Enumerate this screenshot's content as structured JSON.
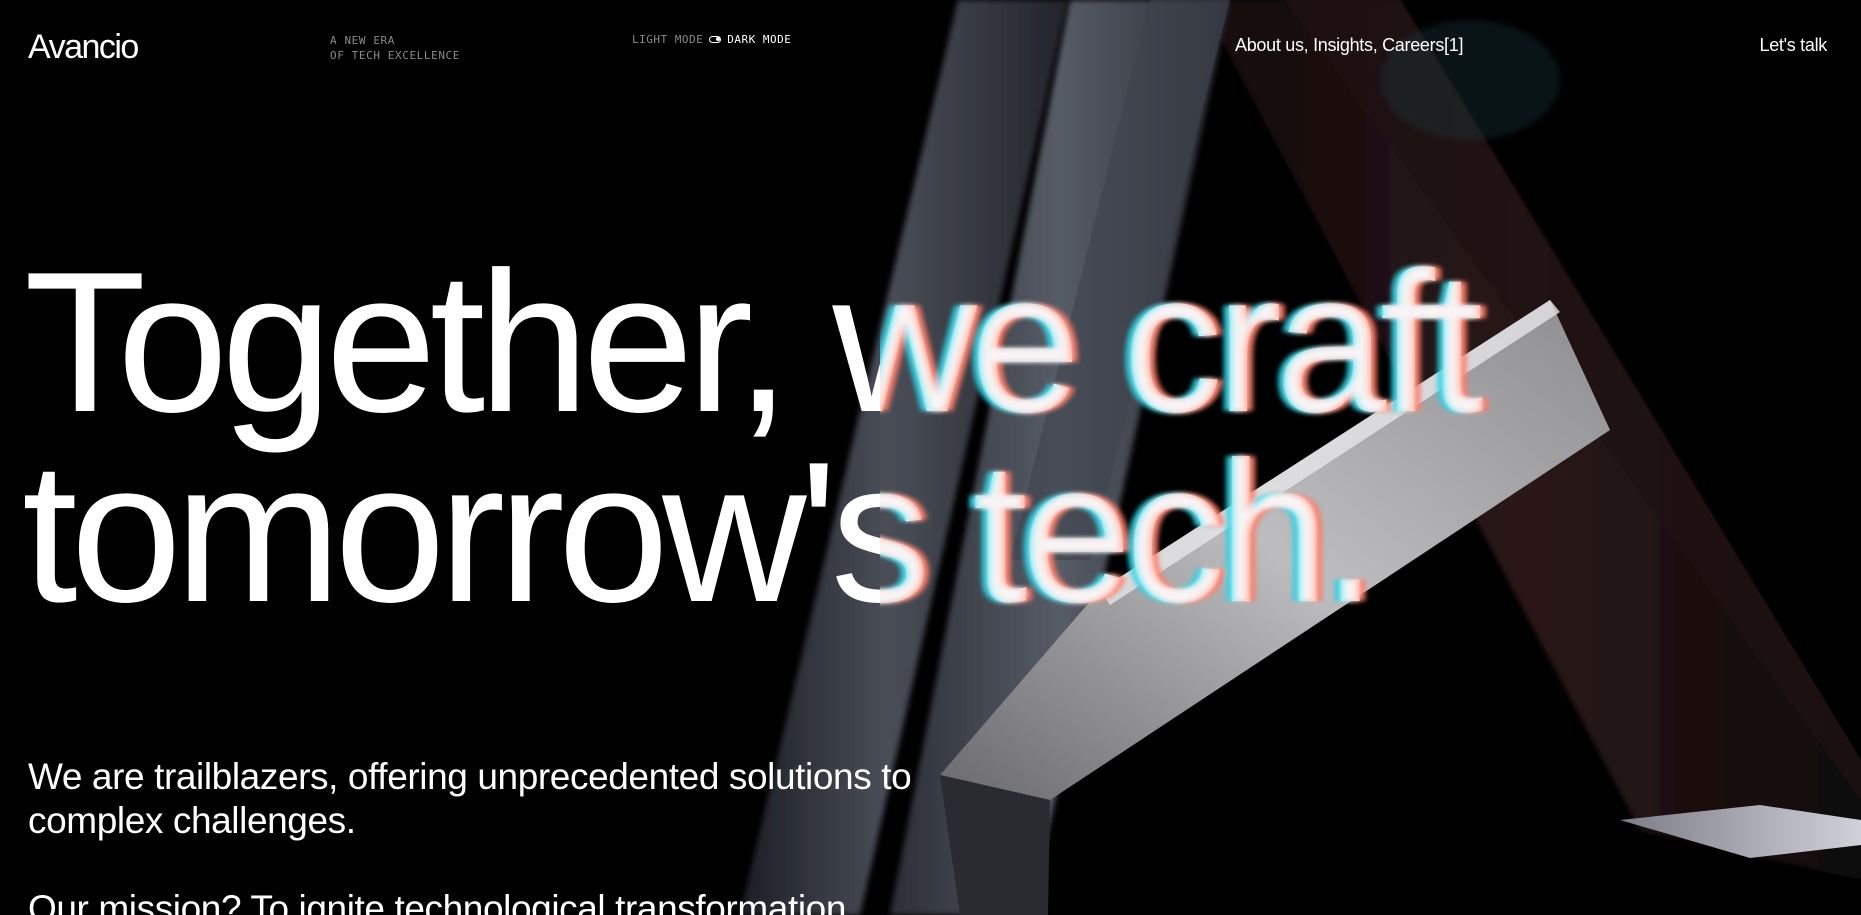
{
  "header": {
    "logo": "Avancio",
    "tagline": [
      "A NEW ERA",
      "OF TECH EXCELLENCE"
    ],
    "mode_switch": {
      "light_label": "LIGHT MODE",
      "dark_label": "DARK MODE",
      "active": "dark"
    },
    "nav": {
      "items": [
        "About us",
        "Insights",
        "Careers"
      ],
      "separator": ", ",
      "careers_count": "[1]"
    },
    "cta_label": "Let's talk"
  },
  "hero": {
    "title_line_1": "Together, we craft",
    "title_line_2": "tomorrow's tech."
  },
  "intro": {
    "statement": "We are trailblazers, offering unprecedented solutions to complex challenges.",
    "mission": "Our mission? To ignite technological transformation"
  },
  "colors": {
    "background": "#000000",
    "text": "#ffffff",
    "muted": "#8a8a8a"
  },
  "icons": {
    "mode_toggle": "toggle-switch-icon"
  }
}
